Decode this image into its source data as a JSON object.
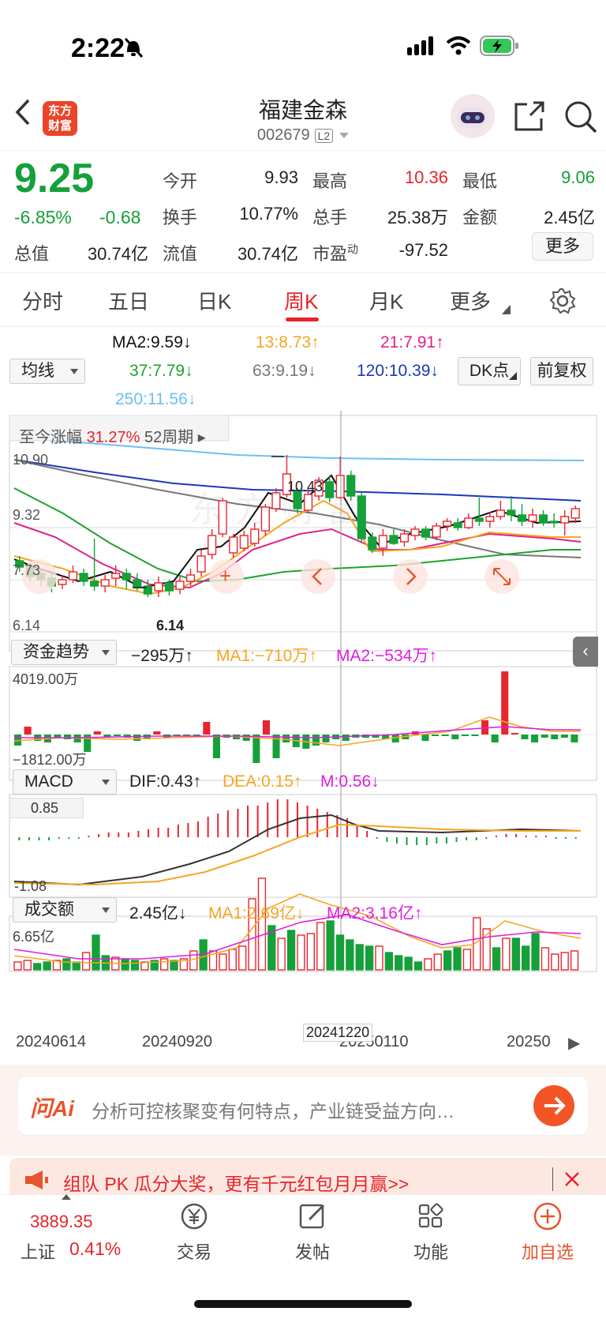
{
  "status_bar": {
    "time": "2:22"
  },
  "nav": {
    "logo_line1": "东方",
    "logo_line2": "财富",
    "title": "福建金森",
    "code": "002679",
    "level": "L2"
  },
  "quote": {
    "price": "9.25",
    "change_pct": "-6.85%",
    "change_amt": "-0.68",
    "open_label": "今开",
    "open": "9.93",
    "high_label": "最高",
    "high": "10.36",
    "low_label": "最低",
    "low": "9.06",
    "turnover_label": "换手",
    "turnover": "10.77%",
    "volume_label": "总手",
    "volume": "25.38万",
    "amount_label": "金额",
    "amount": "2.45亿",
    "total_cap_label": "总值",
    "total_cap": "30.74亿",
    "float_cap_label": "流值",
    "float_cap": "30.74亿",
    "pe_label": "市盈",
    "pe_sup": "动",
    "pe": "-97.52",
    "more_label": "更多"
  },
  "tabs": {
    "items": [
      "分时",
      "五日",
      "日K",
      "周K",
      "月K",
      "更多"
    ],
    "active": "周K"
  },
  "ma_panel": {
    "select": "均线",
    "ma2": "MA2:9.59↓",
    "ma13": "13:8.73↑",
    "ma21": "21:7.91↑",
    "ma37": "37:7.79↓",
    "ma63": "63:9.19↓",
    "ma120": "120:10.39↓",
    "ma250": "250:11.56↓",
    "dk_label": "DK点",
    "fq_label": "前复权"
  },
  "kline": {
    "range_label": "至今涨幅",
    "range_pct": "31.27%",
    "range_period": "52周期",
    "y_labels": [
      "10.90",
      "9.32",
      "7.73",
      "6.14"
    ],
    "max_label": "10.43",
    "min_label": "6.14"
  },
  "fund_flow": {
    "select": "资金趋势",
    "value": "−295万↑",
    "ma1": "MA1:−710万↑",
    "ma2": "MA2:−534万↑",
    "top": "4019.00万",
    "bottom": "−1812.00万"
  },
  "macd": {
    "select": "MACD",
    "dif": "DIF:0.43↑",
    "dea": "DEA:0.15↑",
    "m": "M:0.56↓",
    "top": "0.85",
    "bottom": "-1.08"
  },
  "volume": {
    "select": "成交额",
    "value": "2.45亿↓",
    "ma1": "MA1:2.69亿↓",
    "ma2": "MA2:3.16亿↑",
    "top": "6.65亿"
  },
  "x_axis": {
    "labels": [
      "20240614",
      "20240920",
      "20250110",
      "20250"
    ],
    "crosshair_label": "20241220"
  },
  "ai": {
    "logo": "问Ai",
    "placeholder": "分析可控核聚变有何特点，产业链受益方向…"
  },
  "banner": {
    "text": "组队 PK 瓜分大奖，更有千元红包月月赢>>"
  },
  "bottom_nav": {
    "index_value": "3889.35",
    "index_name": "上证",
    "index_pct": "0.41%",
    "trade": "交易",
    "post": "发帖",
    "func": "功能",
    "add": "加自选"
  },
  "colors": {
    "red": "#e8242c",
    "green": "#15a03a",
    "ma2": "#111111",
    "ma13": "#f5a623",
    "ma21": "#e0218a",
    "ma37": "#1fa32a",
    "ma63": "#888888",
    "ma120": "#1a3ab8",
    "ma250": "#6cc0f5"
  }
}
